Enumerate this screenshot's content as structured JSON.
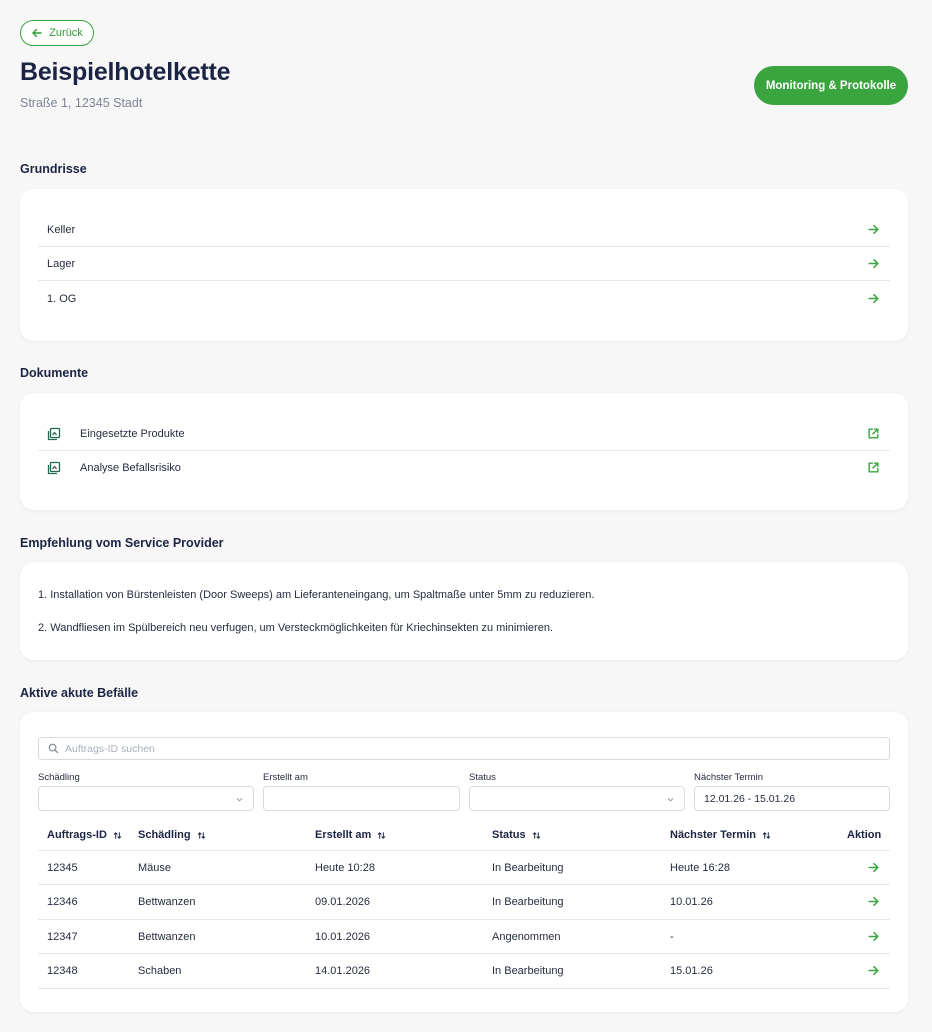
{
  "header": {
    "back_label": "Zurück",
    "title": "Beispielhotelkette",
    "address": "Straße 1, 12345 Stadt",
    "monitoring_label": "Monitoring & Protokolle"
  },
  "floorplans": {
    "title": "Grundrisse",
    "items": [
      {
        "label": "Keller"
      },
      {
        "label": "Lager"
      },
      {
        "label": "1. OG"
      }
    ]
  },
  "documents": {
    "title": "Dokumente",
    "items": [
      {
        "label": "Eingesetzte Produkte"
      },
      {
        "label": "Analyse Befallsrisiko"
      }
    ]
  },
  "recommendations": {
    "title": "Empfehlung vom Service Provider",
    "items": [
      "1. Installation von Bürstenleisten (Door Sweeps) am Lieferanteneingang, um Spaltmaße unter 5mm zu reduzieren.",
      "2. Wandfliesen im Spülbereich neu verfugen, um Versteckmöglichkeiten für Kriechinsekten zu minimieren."
    ]
  },
  "infestations": {
    "title": "Aktive akute Befälle",
    "search_placeholder": "Auftrags-ID suchen",
    "filters": {
      "pest_label": "Schädling",
      "pest_value": "",
      "created_label": "Erstellt am",
      "created_value": "",
      "status_label": "Status",
      "status_value": "",
      "next_label": "Nächster Termin",
      "next_value": "12.01.26 - 15.01.26"
    },
    "columns": [
      "Auftrags-ID",
      "Schädling",
      "Erstellt am",
      "Status",
      "Nächster Termin",
      "Aktion"
    ],
    "rows": [
      {
        "id": "12345",
        "pest": "Mäuse",
        "created": "Heute 10:28",
        "status": "In Bearbeitung",
        "next": "Heute 16:28"
      },
      {
        "id": "12346",
        "pest": "Bettwanzen",
        "created": "09.01.2026",
        "status": "In Bearbeitung",
        "next": "10.01.26"
      },
      {
        "id": "12347",
        "pest": "Bettwanzen",
        "created": "10.01.2026",
        "status": "Angenommen",
        "next": "-"
      },
      {
        "id": "12348",
        "pest": "Schaben",
        "created": "14.01.2026",
        "status": "In Bearbeitung",
        "next": "15.01.26"
      }
    ]
  },
  "colors": {
    "accent": "#3aa53f",
    "title": "#1b2444",
    "background": "#f6f7f6",
    "doc_icon": "#1f6b52"
  },
  "icons": {
    "back": "arrow-left-icon",
    "row": "arrow-right-icon",
    "document": "document-stack-icon",
    "external": "external-link-icon",
    "search": "search-icon",
    "dropdown": "chevron-down-icon",
    "sort": "sort-icon"
  }
}
